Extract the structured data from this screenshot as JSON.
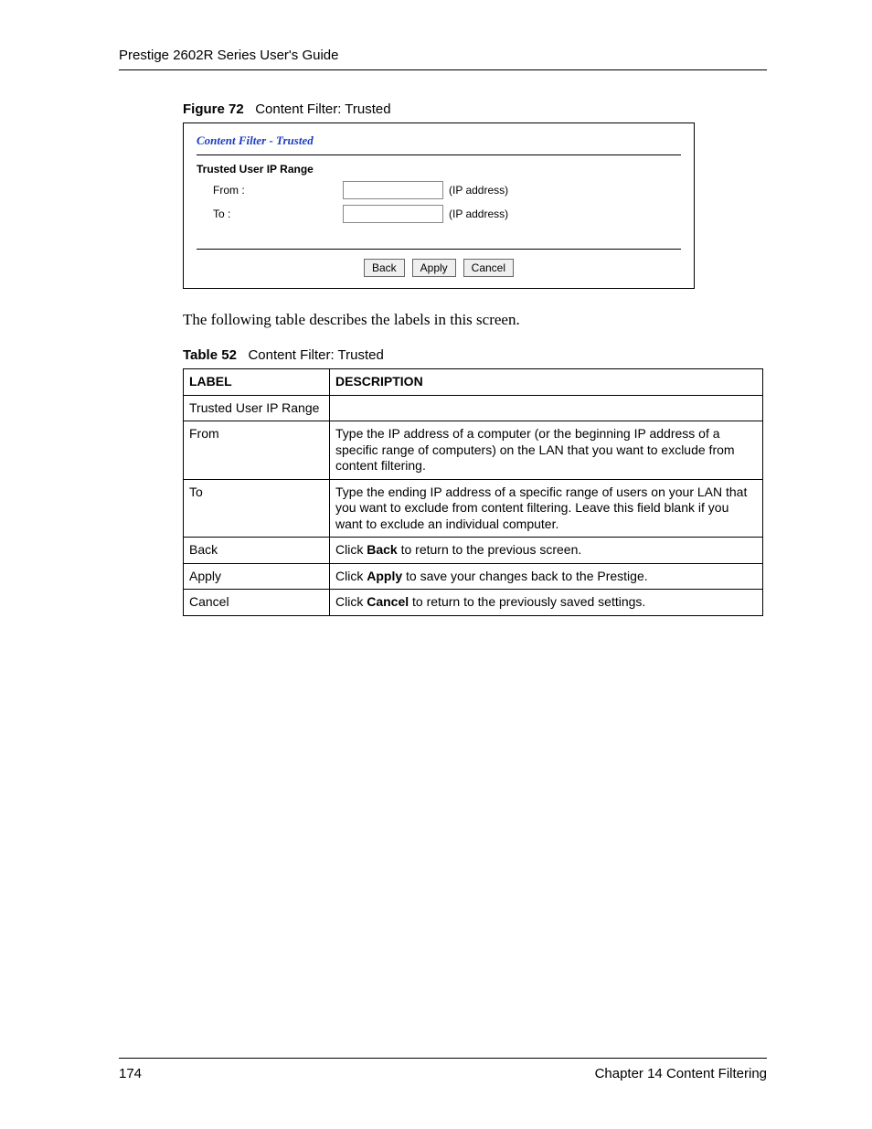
{
  "header": {
    "title": "Prestige 2602R Series User's Guide"
  },
  "figure": {
    "label": "Figure 72",
    "title": "Content Filter: Trusted"
  },
  "screenshot": {
    "title": "Content Filter - Trusted",
    "section": "Trusted User IP Range",
    "from_label": "From :",
    "to_label": "To :",
    "from_hint": "(IP address)",
    "to_hint": "(IP address)",
    "buttons": {
      "back": "Back",
      "apply": "Apply",
      "cancel": "Cancel"
    }
  },
  "paragraph": "The following table describes the labels in this screen.",
  "table": {
    "label": "Table 52",
    "title": "Content Filter: Trusted",
    "headers": {
      "c1": "LABEL",
      "c2": "DESCRIPTION"
    },
    "rows": [
      {
        "label": "Trusted User IP Range",
        "desc": ""
      },
      {
        "label": "From",
        "desc": "Type the IP address of a computer (or the beginning IP address of a specific range of computers) on the LAN that you want to exclude from content filtering."
      },
      {
        "label": "To",
        "desc": "Type the ending IP address of a specific range of users on your LAN that you want to exclude from content filtering. Leave this field blank if you want to exclude an individual computer."
      },
      {
        "label": "Back",
        "desc_pre": "Click ",
        "desc_bold": "Back",
        "desc_post": " to return to the previous screen."
      },
      {
        "label": "Apply",
        "desc_pre": "Click ",
        "desc_bold": "Apply",
        "desc_post": " to save your changes back to the Prestige."
      },
      {
        "label": "Cancel",
        "desc_pre": "Click ",
        "desc_bold": "Cancel",
        "desc_post": " to return to the previously saved settings."
      }
    ]
  },
  "footer": {
    "page": "174",
    "chapter": "Chapter 14 Content Filtering"
  }
}
